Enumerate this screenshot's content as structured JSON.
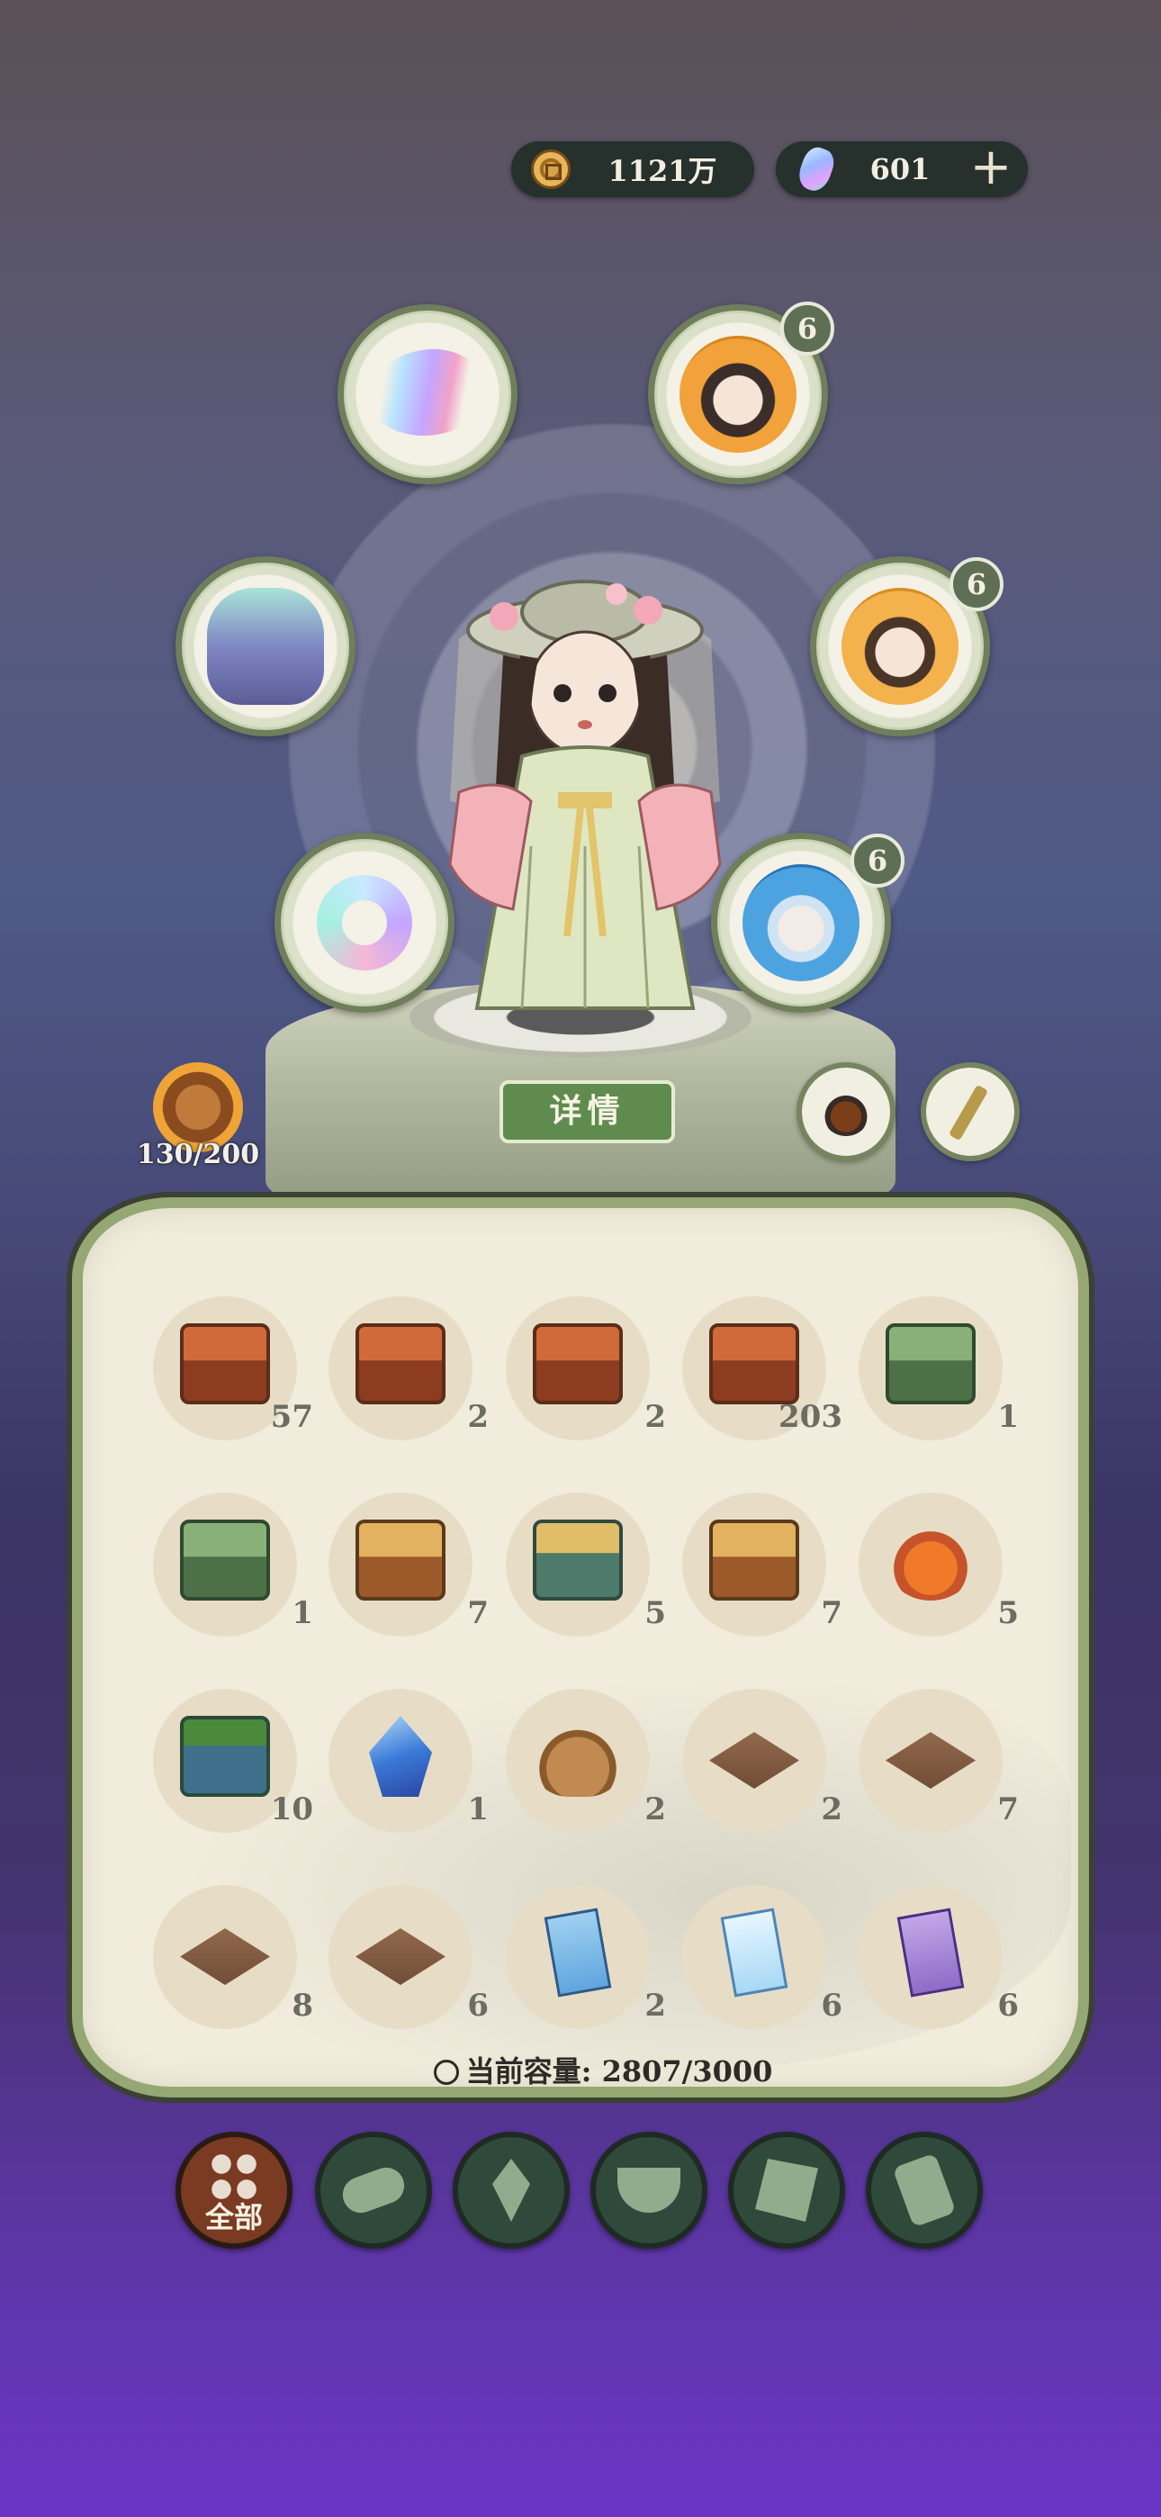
{
  "currency": {
    "coins": "1121万",
    "gems": "601",
    "add_label": "+"
  },
  "hero": {
    "stamina": "130/200",
    "detail_label": "详情"
  },
  "slots": {
    "hero1_level": "6",
    "hero2_level": "6",
    "hero3_level": "6"
  },
  "inventory": {
    "items": [
      {
        "icon": "red-treasure-chest",
        "count": "57"
      },
      {
        "icon": "red-treasure-chest",
        "count": "2"
      },
      {
        "icon": "red-treasure-chest",
        "count": "2"
      },
      {
        "icon": "red-treasure-chest",
        "count": "203"
      },
      {
        "icon": "green-treasure-chest",
        "count": "1"
      },
      {
        "icon": "green-treasure-chest",
        "count": "1"
      },
      {
        "icon": "brown-treasure-chest",
        "count": "7"
      },
      {
        "icon": "teal-treasure-chest",
        "count": "5"
      },
      {
        "icon": "brown-treasure-chest",
        "count": "7"
      },
      {
        "icon": "orange-pouch",
        "count": "5"
      },
      {
        "icon": "palm-treasure-chest",
        "count": "10"
      },
      {
        "icon": "blue-crystal",
        "count": "1"
      },
      {
        "icon": "cloth-sack",
        "count": "2"
      },
      {
        "icon": "wooden-plate",
        "count": "2"
      },
      {
        "icon": "wooden-plate",
        "count": "7"
      },
      {
        "icon": "wooden-plate",
        "count": "8"
      },
      {
        "icon": "wooden-plate",
        "count": "6"
      },
      {
        "icon": "blue-scroll",
        "count": "2"
      },
      {
        "icon": "ice-scroll",
        "count": "6"
      },
      {
        "icon": "purple-scroll",
        "count": "6"
      }
    ],
    "capacity_label": "当前容量:",
    "capacity_value": "2807/3000"
  },
  "tabs": {
    "all_label": "全部"
  }
}
